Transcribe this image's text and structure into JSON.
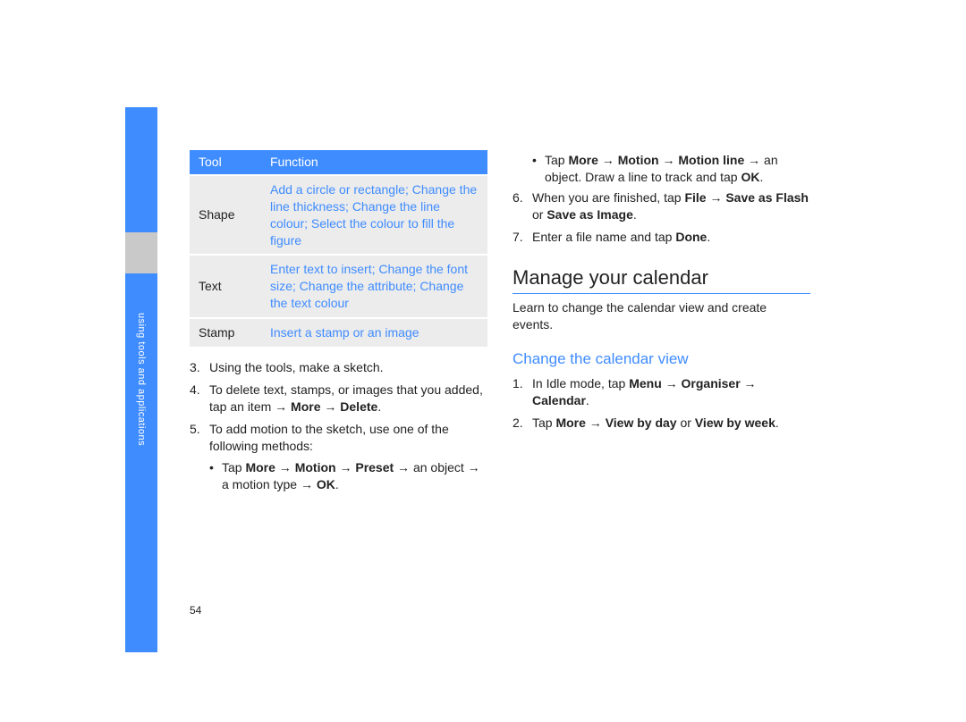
{
  "sidebar_label": "using tools and applications",
  "page_number": "54",
  "table": {
    "header_tool": "Tool",
    "header_function": "Function",
    "rows": [
      {
        "tool": "Shape",
        "func": "Add a circle or rectangle; Change the line thickness; Change the line colour; Select the colour to fill the figure"
      },
      {
        "tool": "Text",
        "func": "Enter text to insert; Change the font size; Change the attribute; Change the text colour"
      },
      {
        "tool": "Stamp",
        "func": "Insert a stamp or an image"
      }
    ]
  },
  "left_steps": {
    "s3_num": "3.",
    "s3": "Using the tools, make a sketch.",
    "s4_num": "4.",
    "s4_a": "To delete text, stamps, or images that you added, tap an item → ",
    "s4_b_bold1": "More",
    "s4_b_mid": " → ",
    "s4_b_bold2": "Delete",
    "s4_b_end": ".",
    "s5_num": "5.",
    "s5": "To add motion to the sketch, use one of the following methods:",
    "b1_pre": "Tap ",
    "b1_bold1": "More",
    "b1_mid1": " → ",
    "b1_bold2": "Motion",
    "b1_mid2": " → ",
    "b1_bold3": "Preset",
    "b1_mid3": " → an object → a motion type → ",
    "b1_bold4": "OK",
    "b1_end": "."
  },
  "right_top": {
    "b2_pre": "Tap ",
    "b2_bold1": "More",
    "b2_mid1": " → ",
    "b2_bold2": "Motion",
    "b2_mid2": " → ",
    "b2_bold3": "Motion line",
    "b2_mid3": " → an object. Draw a line to track and tap ",
    "b2_bold4": "OK",
    "b2_end": ".",
    "s6_num": "6.",
    "s6_a": "When you are finished, tap ",
    "s6_bold1": "File",
    "s6_mid1": " → ",
    "s6_bold2": "Save as Flash",
    "s6_mid2": " or ",
    "s6_bold3": "Save as Image",
    "s6_end": ".",
    "s7_num": "7.",
    "s7_a": "Enter a file name and tap ",
    "s7_bold": "Done",
    "s7_end": "."
  },
  "calendar": {
    "title": "Manage your calendar",
    "intro": "Learn to change the calendar view and create events.",
    "sub1": "Change the calendar view",
    "s1_num": "1.",
    "s1_a": "In Idle mode, tap ",
    "s1_bold1": "Menu",
    "s1_mid1": " → ",
    "s1_bold2": "Organiser",
    "s1_mid2": " → ",
    "s1_bold3": "Calendar",
    "s1_end": ".",
    "s2_num": "2.",
    "s2_a": "Tap ",
    "s2_bold1": "More",
    "s2_mid1": " → ",
    "s2_bold2": "View by day",
    "s2_mid2": " or ",
    "s2_bold3": "View by week",
    "s2_end": "."
  }
}
